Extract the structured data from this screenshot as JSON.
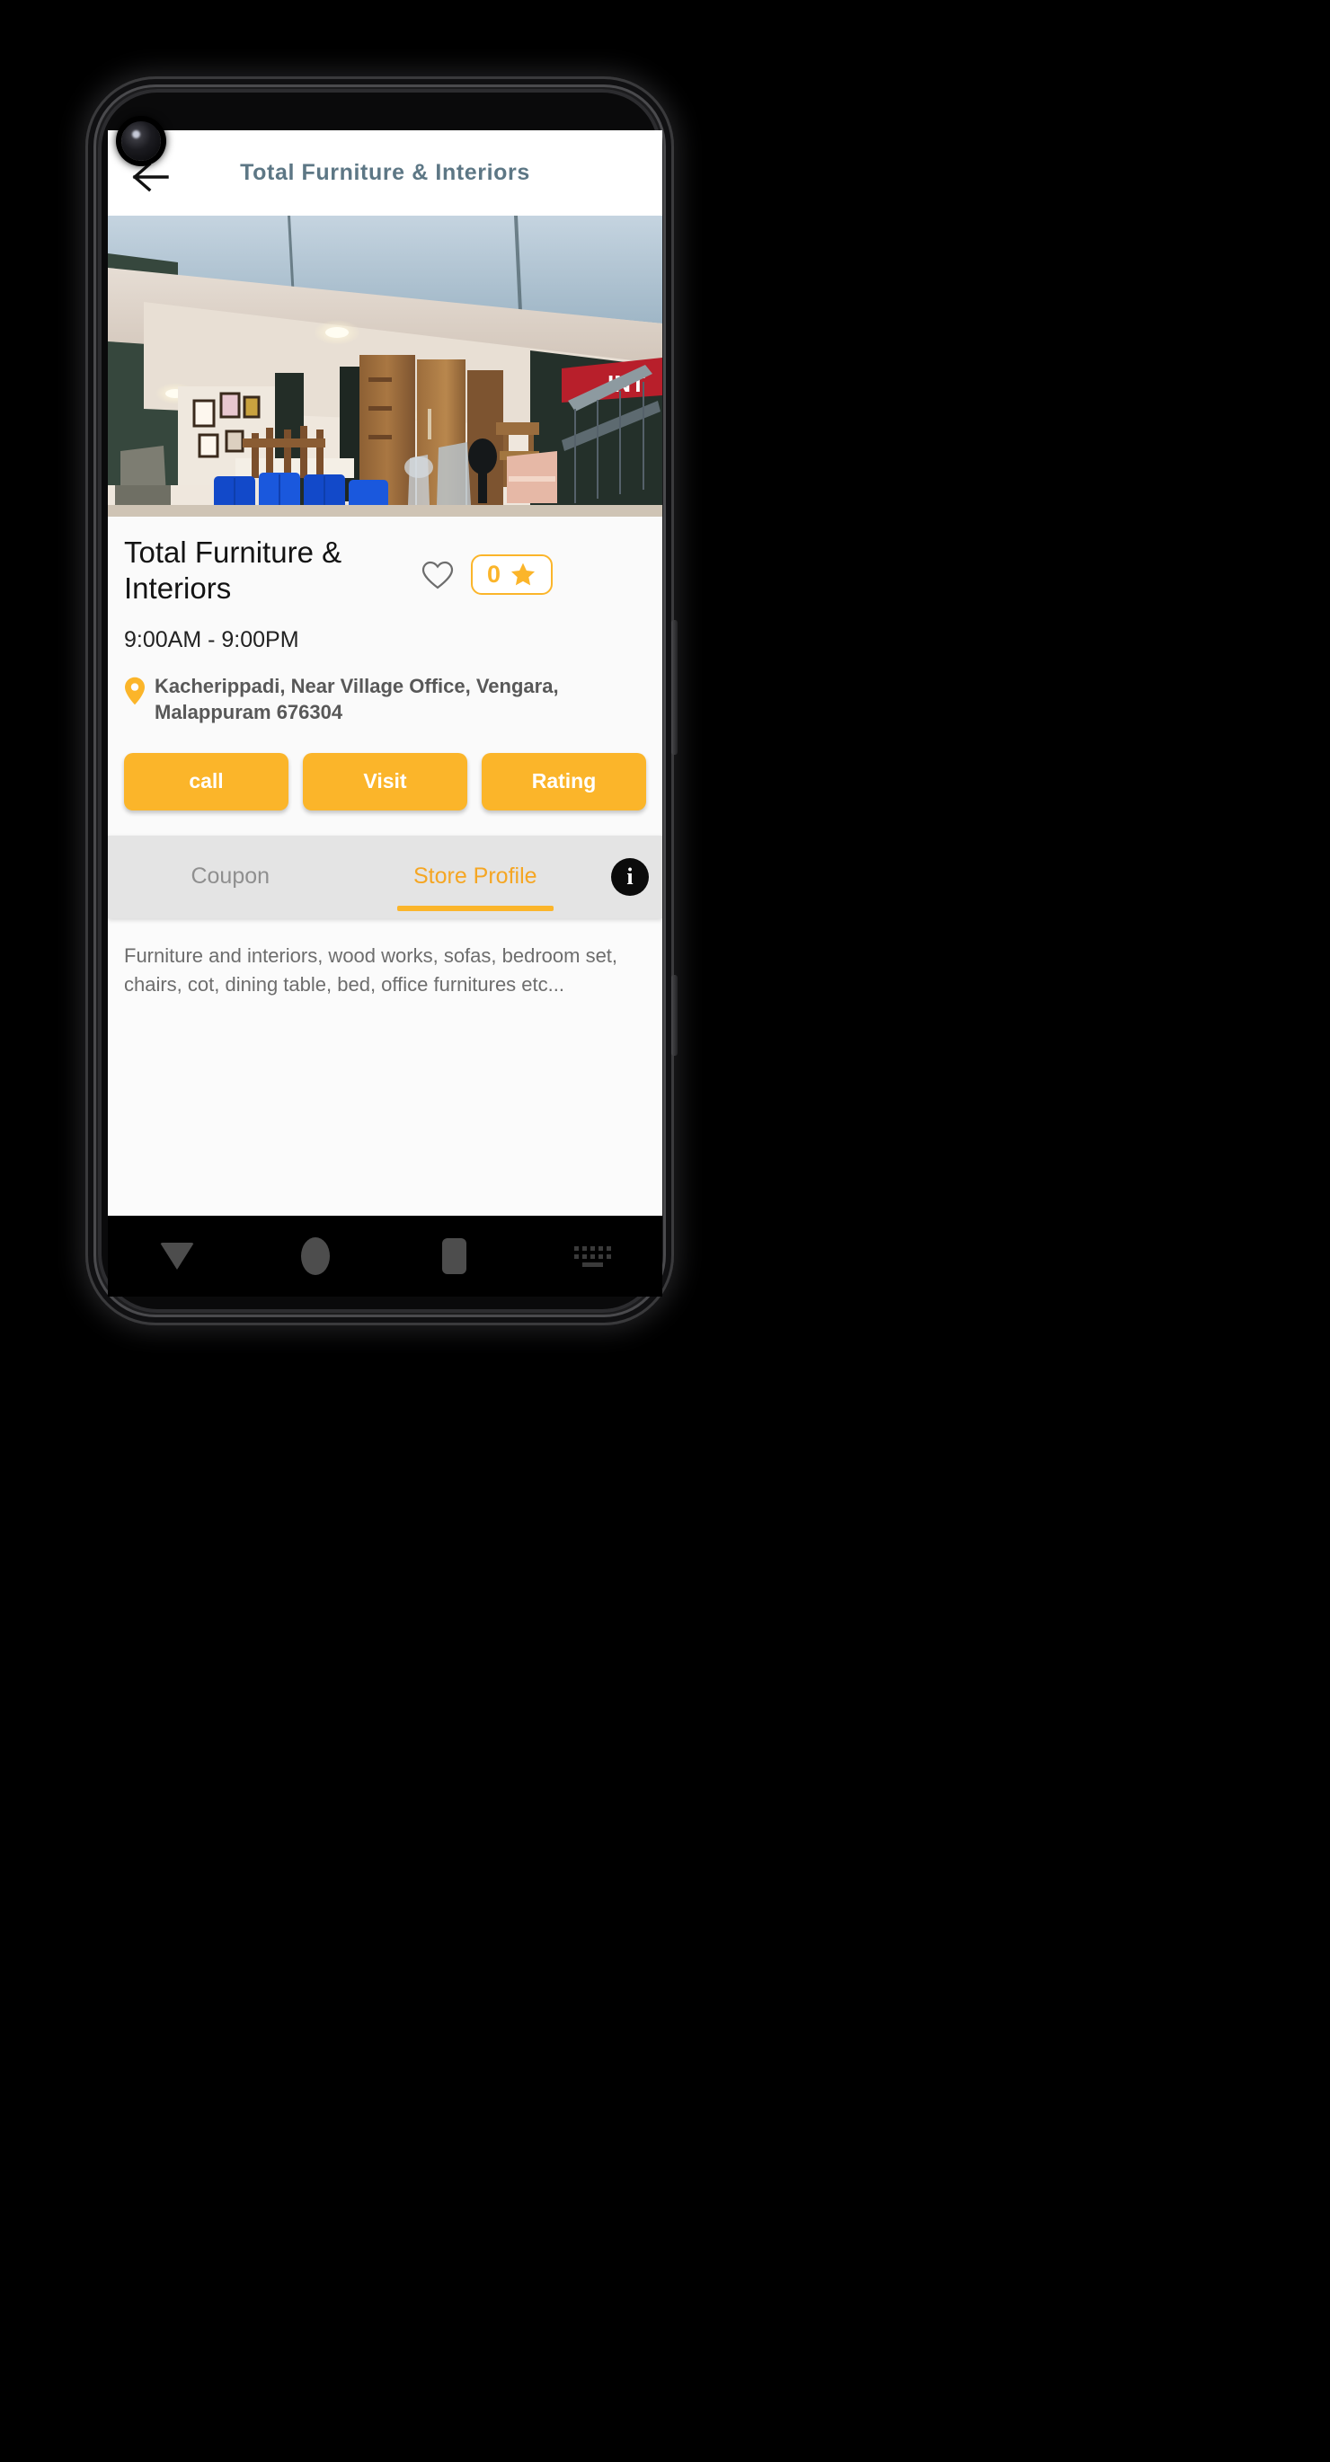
{
  "appbar": {
    "title": "Total Furniture & Interiors",
    "back_icon": "arrow-left-icon",
    "title_color": "#5d7785"
  },
  "hero": {
    "alt": "Furniture showroom interior with wooden wardrobes, blue sofas and staircase",
    "sign_text": "INT"
  },
  "store": {
    "name": "Total Furniture & Interiors",
    "hours": "9:00AM - 9:00PM",
    "address": "Kacherippadi, Near Village Office, Vengara, Malappuram 676304",
    "favorite_icon": "heart-outline-icon",
    "location_icon": "map-pin-icon",
    "rating_value": "0",
    "rating_icon": "star-filled-icon"
  },
  "actions": {
    "buttons": [
      {
        "label": "call",
        "name": "call-button"
      },
      {
        "label": "Visit",
        "name": "visit-button"
      },
      {
        "label": "Rating",
        "name": "rating-button"
      }
    ]
  },
  "tabs": {
    "items": [
      {
        "label": "Coupon",
        "active": false
      },
      {
        "label": "Store Profile",
        "active": true
      }
    ],
    "info_icon_glyph": "i",
    "info_icon_name": "info-icon"
  },
  "profile": {
    "description": "Furniture and interiors, wood works, sofas, bedroom set, chairs, cot, dining table, bed, office furnitures etc..."
  },
  "navbar": {
    "items": [
      "back",
      "home",
      "recents",
      "keyboard"
    ]
  },
  "colors": {
    "accent": "#fbb52a",
    "tab_active": "#f5a623",
    "tab_inactive": "#8f8f8f",
    "title": "#5d7785",
    "body_text": "#6d6d6d",
    "address_text": "#585858",
    "tabbar_bg": "#e4e4e4"
  }
}
